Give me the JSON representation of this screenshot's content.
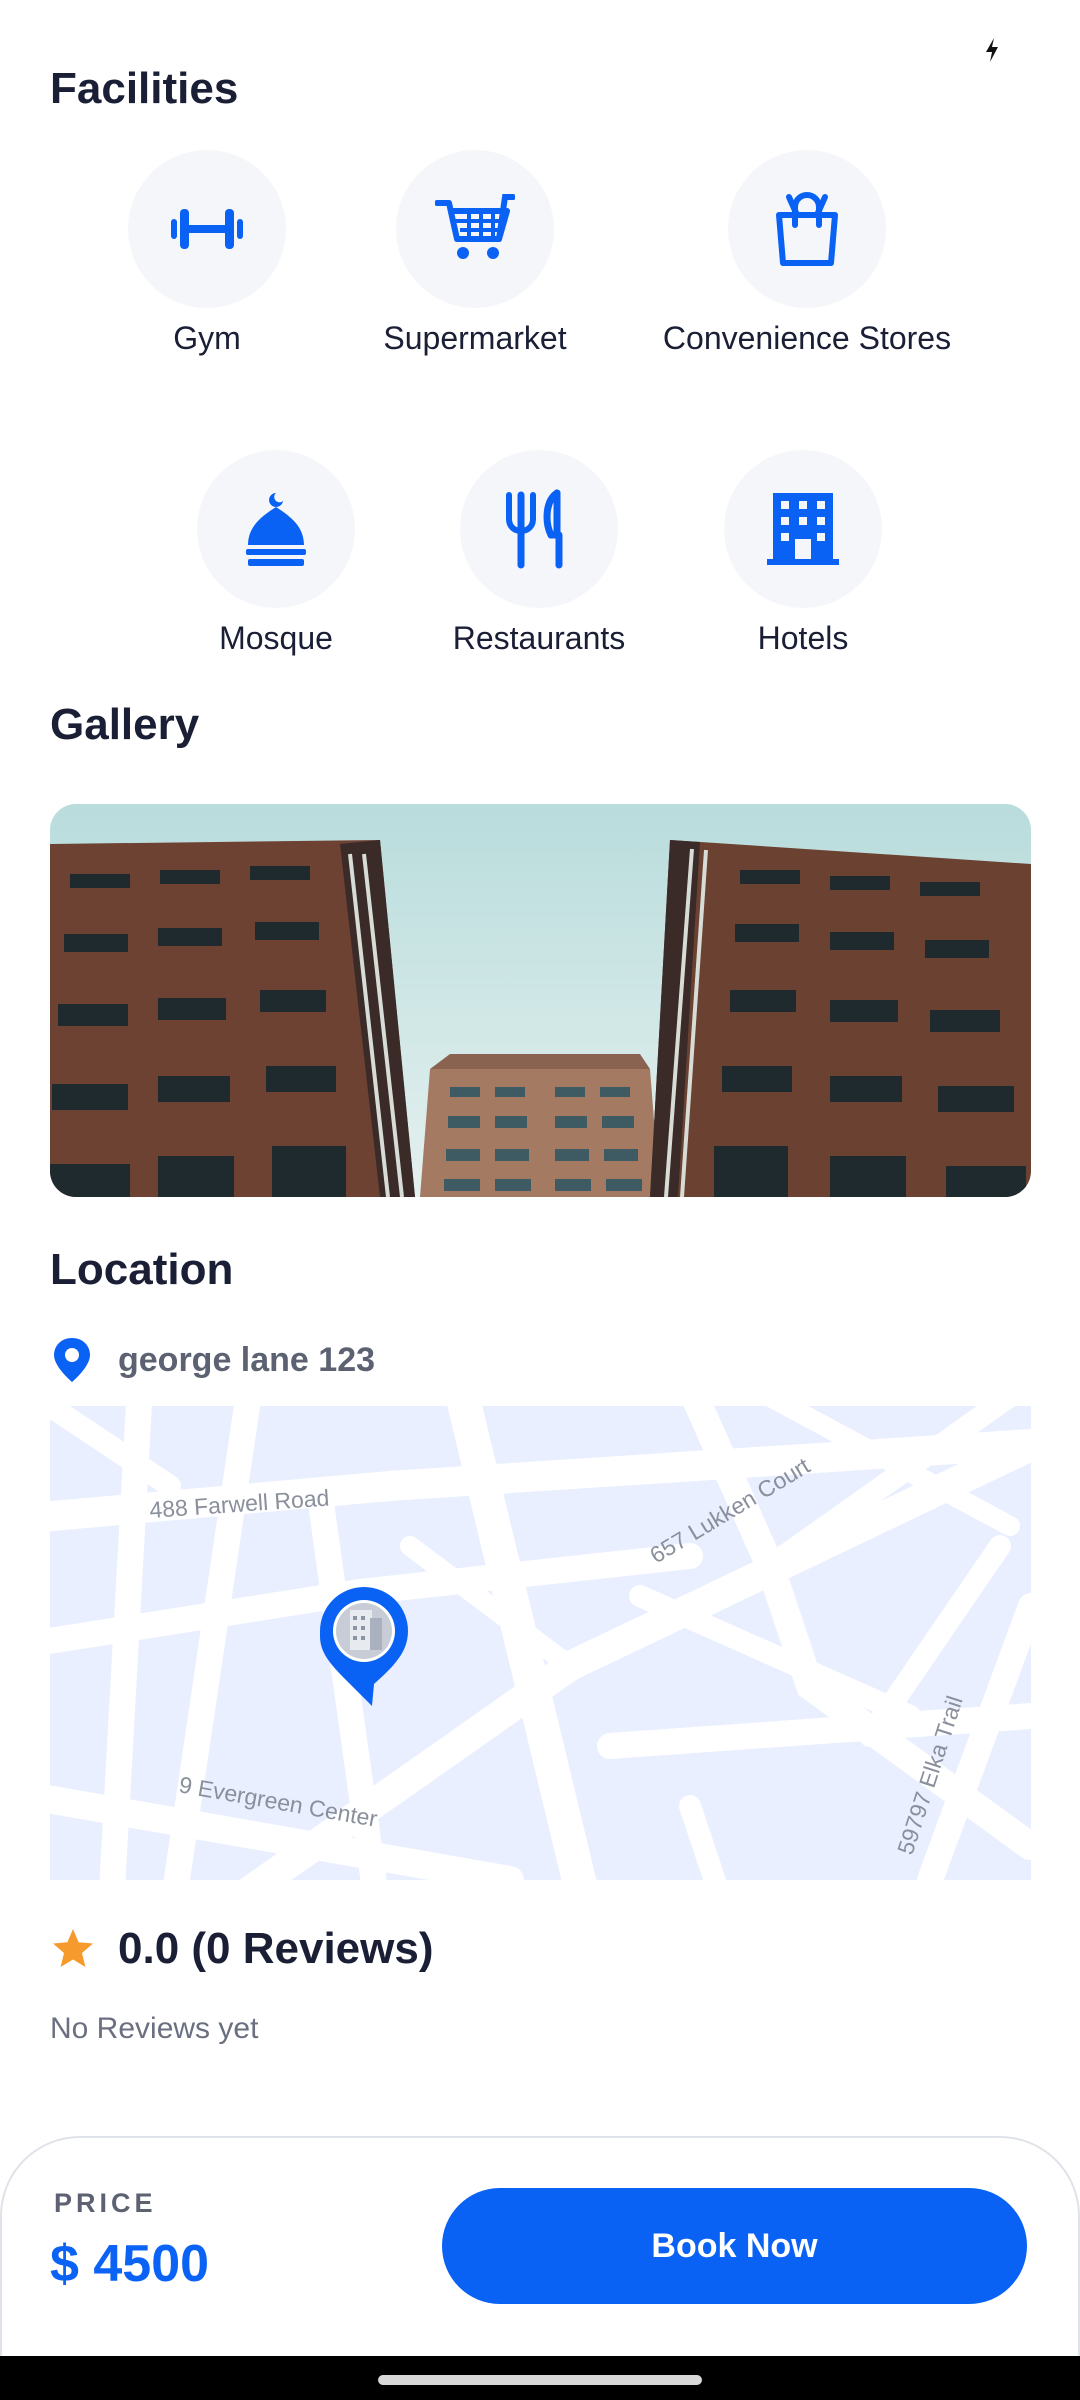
{
  "facilities": {
    "title": "Facilities",
    "items": [
      {
        "label": "Gym",
        "icon": "dumbbell-icon"
      },
      {
        "label": "Supermarket",
        "icon": "cart-icon"
      },
      {
        "label": "Convenience Stores",
        "icon": "shopping-bag-icon"
      },
      {
        "label": "Mosque",
        "icon": "mosque-icon"
      },
      {
        "label": "Restaurants",
        "icon": "fork-knife-icon"
      },
      {
        "label": "Hotels",
        "icon": "building-icon"
      }
    ]
  },
  "gallery": {
    "title": "Gallery"
  },
  "location": {
    "title": "Location",
    "address": "george lane 123",
    "map_streets": [
      "488 Farwell Road",
      "657 Lukken Court",
      "9 Evergreen Center",
      "59797 Elka Trail"
    ]
  },
  "rating": {
    "score_text": "0.0 (0 Reviews)",
    "empty_text": "No Reviews yet"
  },
  "booking": {
    "price_label": "PRICE",
    "price_value": "$ 4500",
    "book_label": "Book Now"
  },
  "colors": {
    "accent": "#0a62f5",
    "star": "#f79a2d",
    "map_bg": "#e9efff"
  }
}
